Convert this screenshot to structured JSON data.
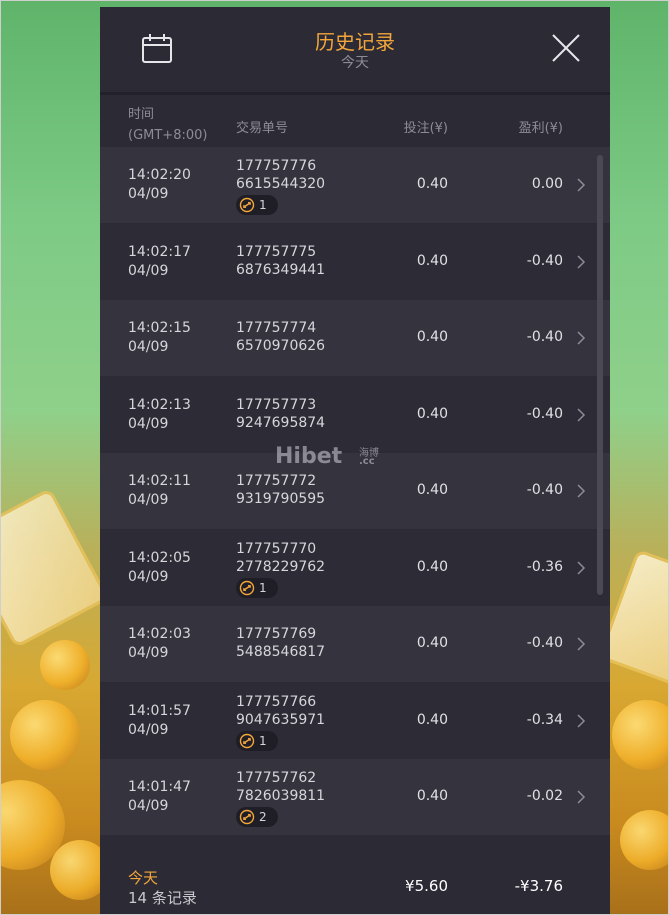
{
  "header": {
    "title": "历史记录",
    "subtitle": "今天"
  },
  "columns": {
    "time": "时间",
    "timezone": "(GMT+8:00)",
    "order": "交易单号",
    "bet": "投注(¥)",
    "profit": "盈利(¥)"
  },
  "rows": [
    {
      "time": "14:02:20",
      "date": "04/09",
      "order_line1": "177757776",
      "order_line2": "6615544320",
      "bet": "0.40",
      "profit": "0.00",
      "badge": "1"
    },
    {
      "time": "14:02:17",
      "date": "04/09",
      "order_line1": "177757775",
      "order_line2": "6876349441",
      "bet": "0.40",
      "profit": "-0.40",
      "badge": null
    },
    {
      "time": "14:02:15",
      "date": "04/09",
      "order_line1": "177757774",
      "order_line2": "6570970626",
      "bet": "0.40",
      "profit": "-0.40",
      "badge": null
    },
    {
      "time": "14:02:13",
      "date": "04/09",
      "order_line1": "177757773",
      "order_line2": "9247695874",
      "bet": "0.40",
      "profit": "-0.40",
      "badge": null
    },
    {
      "time": "14:02:11",
      "date": "04/09",
      "order_line1": "177757772",
      "order_line2": "9319790595",
      "bet": "0.40",
      "profit": "-0.40",
      "badge": null
    },
    {
      "time": "14:02:05",
      "date": "04/09",
      "order_line1": "177757770",
      "order_line2": "2778229762",
      "bet": "0.40",
      "profit": "-0.36",
      "badge": "1"
    },
    {
      "time": "14:02:03",
      "date": "04/09",
      "order_line1": "177757769",
      "order_line2": "5488546817",
      "bet": "0.40",
      "profit": "-0.40",
      "badge": null
    },
    {
      "time": "14:01:57",
      "date": "04/09",
      "order_line1": "177757766",
      "order_line2": "9047635971",
      "bet": "0.40",
      "profit": "-0.34",
      "badge": "1"
    },
    {
      "time": "14:01:47",
      "date": "04/09",
      "order_line1": "177757762",
      "order_line2": "7826039811",
      "bet": "0.40",
      "profit": "-0.02",
      "badge": "2"
    }
  ],
  "footer": {
    "period": "今天",
    "records": "14 条记录",
    "total_bet": "¥5.60",
    "total_profit": "-¥3.76"
  },
  "watermark": {
    "brand": "Hibet",
    "cn": "海博",
    "domain": ".cc"
  },
  "colors": {
    "accent": "#f3a63a",
    "panel": "#2b2a35",
    "row_light": "#35343e",
    "row_dark": "#2c2b36"
  },
  "icons": {
    "header_left": "calendar-icon",
    "header_right": "close-icon",
    "row_action": "chevron-right-icon",
    "badge": "free-spin-icon"
  }
}
